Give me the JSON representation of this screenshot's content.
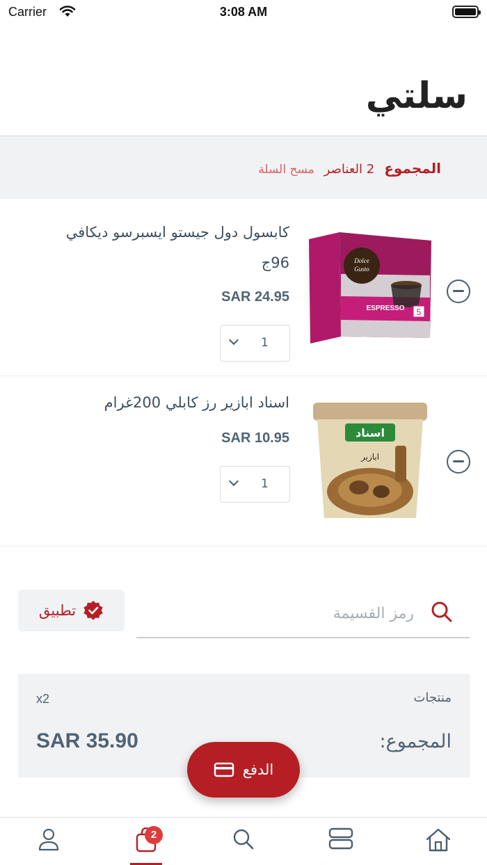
{
  "status_bar": {
    "carrier": "Carrier",
    "time": "3:08 AM"
  },
  "header": {
    "title": "سلتي"
  },
  "summary": {
    "total_label": "المجموع",
    "items_count": "2 العناصر",
    "clear_cart": "مسح السلة"
  },
  "cart_items": [
    {
      "name": "كابسول دول جيستو ايسبرسو ديكافي 96ج",
      "price": "SAR 24.95",
      "quantity": "1",
      "image": "dolce-gusto-espresso-box"
    },
    {
      "name": "اسناد ابازير رز كابلي 200غرام",
      "price": "SAR 10.95",
      "quantity": "1",
      "image": "isnad-kabli-spice-tub"
    }
  ],
  "coupon": {
    "placeholder": "رمز القسيمة",
    "apply_label": "تطبيق"
  },
  "totals": {
    "products_label": "منتجات",
    "products_count": "x2",
    "total_label": "المجموع:",
    "total_value": "SAR 35.90"
  },
  "checkout": {
    "label": "الدفع"
  },
  "tab_bar": {
    "tabs": [
      "profile-icon",
      "cart-icon",
      "search-icon",
      "categories-icon",
      "home-icon"
    ],
    "cart_badge": "2",
    "active": "cart"
  },
  "colors": {
    "accent": "#b51f24",
    "text": "#3d4f5f",
    "muted_bg": "#f1f2f4"
  }
}
